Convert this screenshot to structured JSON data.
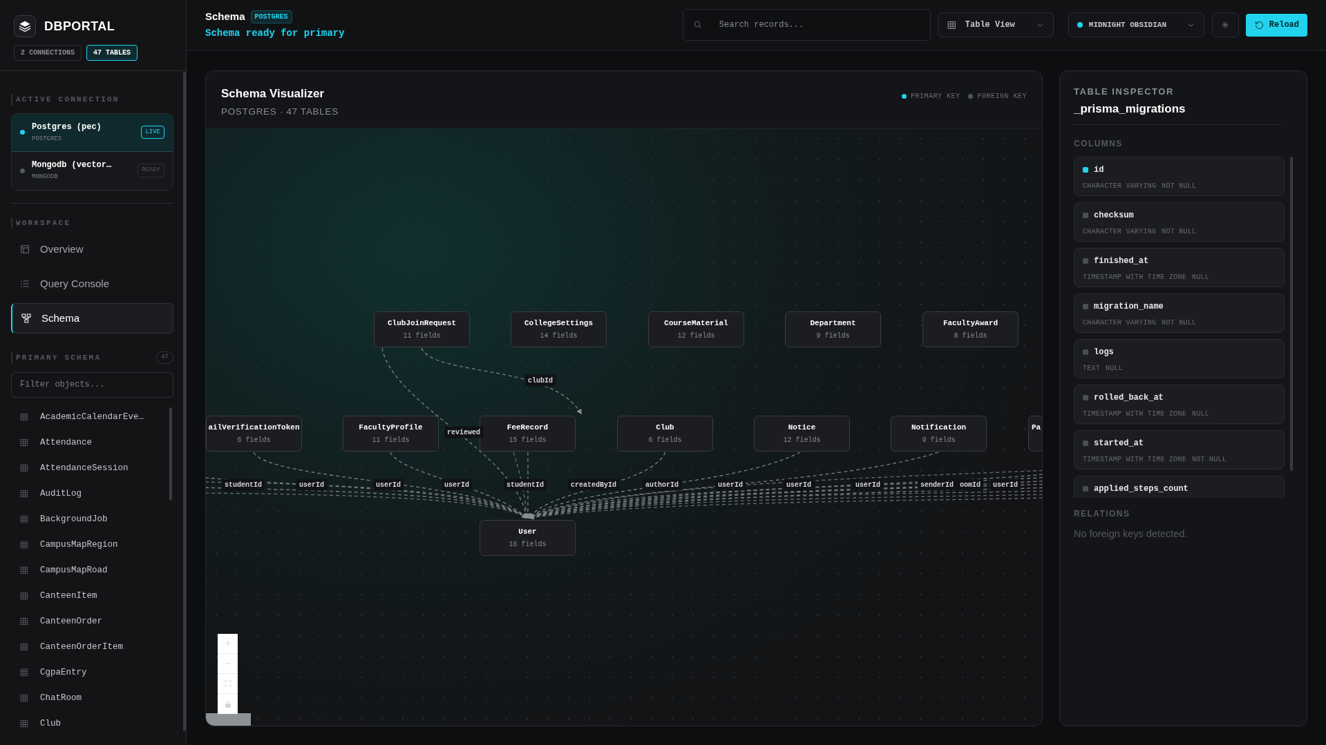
{
  "sidebar": {
    "brand": "DBPORTAL",
    "chips": [
      {
        "label": "2 CONNECTIONS",
        "selected": false
      },
      {
        "label": "47 TABLES",
        "selected": true
      }
    ],
    "active_connection": {
      "heading": "ACTIVE CONNECTION",
      "items": [
        {
          "name": "Postgres (pec)",
          "engine": "POSTGRES",
          "badge": "LIVE",
          "selected": true
        },
        {
          "name": "Mongodb (vector…",
          "engine": "MONGODB",
          "badge": "READY",
          "selected": false
        }
      ]
    },
    "workspace": {
      "heading": "WORKSPACE",
      "items": [
        {
          "label": "Overview",
          "selected": false
        },
        {
          "label": "Query Console",
          "selected": false
        },
        {
          "label": "Schema",
          "selected": true
        }
      ]
    },
    "primary_schema": {
      "heading": "PRIMARY SCHEMA",
      "count": "47",
      "filter_placeholder": "Filter objects...",
      "tables": [
        "AcademicCalendarEve…",
        "Attendance",
        "AttendanceSession",
        "AuditLog",
        "BackgroundJob",
        "CampusMapRegion",
        "CampusMapRoad",
        "CanteenItem",
        "CanteenOrder",
        "CanteenOrderItem",
        "CgpaEntry",
        "ChatRoom",
        "Club"
      ]
    }
  },
  "top_bar": {
    "title": "Schema",
    "badge": "POSTGRES",
    "status": "Schema ready for primary",
    "search_placeholder": "Search records...",
    "view_select": "Table View",
    "theme_select": "MIDNIGHT OBSIDIAN",
    "reload": "Reload"
  },
  "schema_visualizer": {
    "title": "Schema Visualizer",
    "subtitle": "POSTGRES · 47 TABLES",
    "legend": [
      {
        "label": "PRIMARY KEY",
        "color": "#22d3ee"
      },
      {
        "label": "FOREIGN KEY",
        "color": "#4b5563"
      }
    ],
    "tables": [
      {
        "name": "ClubJoinRequest",
        "fields": "11 fields"
      },
      {
        "name": "CollegeSettings",
        "fields": "14 fields"
      },
      {
        "name": "CourseMaterial",
        "fields": "12 fields"
      },
      {
        "name": "Department",
        "fields": "9 fields"
      },
      {
        "name": "FacultyAward",
        "fields": "8 fields"
      },
      {
        "name": "ailVerificationToken",
        "fields": "6 fields"
      },
      {
        "name": "FacultyProfile",
        "fields": "11 fields"
      },
      {
        "name": "FeeRecord",
        "fields": "15 fields"
      },
      {
        "name": "Club",
        "fields": "6 fields"
      },
      {
        "name": "Notice",
        "fields": "12 fields"
      },
      {
        "name": "Notification",
        "fields": "9 fields"
      },
      {
        "name": "Pa"
      },
      {
        "name": "User",
        "fields": "16 fields"
      }
    ],
    "relations": [
      {
        "label": "clubId"
      },
      {
        "label": "reviewed"
      },
      {
        "label": "studentId"
      },
      {
        "label": "userId"
      },
      {
        "label": "userId"
      },
      {
        "label": "userId"
      },
      {
        "label": "studentId"
      },
      {
        "label": "createdById"
      },
      {
        "label": "authorId"
      },
      {
        "label": "userId"
      },
      {
        "label": "userId"
      },
      {
        "label": "userId"
      },
      {
        "label": "senderId"
      },
      {
        "label": "oomId"
      },
      {
        "label": "userId"
      }
    ]
  },
  "table_inspector": {
    "heading": "TABLE INSPECTOR",
    "table": "_prisma_migrations",
    "columns_heading": "COLUMNS",
    "columns": [
      {
        "name": "id",
        "type": "CHARACTER VARYING",
        "nullability": "NOT NULL",
        "primary_key": true
      },
      {
        "name": "checksum",
        "type": "CHARACTER VARYING",
        "nullability": "NOT NULL",
        "primary_key": false
      },
      {
        "name": "finished_at",
        "type": "TIMESTAMP WITH TIME ZONE",
        "nullability": "NULL",
        "primary_key": false
      },
      {
        "name": "migration_name",
        "type": "CHARACTER VARYING",
        "nullability": "NOT NULL",
        "primary_key": false
      },
      {
        "name": "logs",
        "type": "TEXT",
        "nullability": "NULL",
        "primary_key": false
      },
      {
        "name": "rolled_back_at",
        "type": "TIMESTAMP WITH TIME ZONE",
        "nullability": "NULL",
        "primary_key": false
      },
      {
        "name": "started_at",
        "type": "TIMESTAMP WITH TIME ZONE",
        "nullability": "NOT NULL",
        "primary_key": false
      },
      {
        "name": "applied_steps_count",
        "primary_key": false
      }
    ],
    "relations_heading": "RELATIONS",
    "relations_empty": "No foreign keys detected."
  }
}
